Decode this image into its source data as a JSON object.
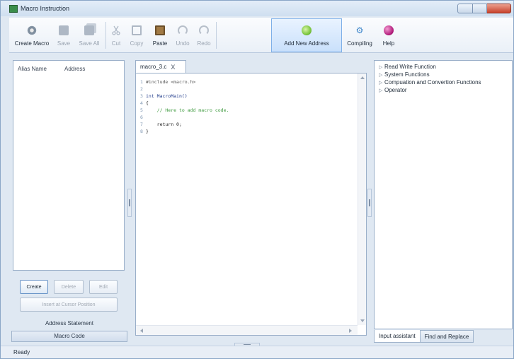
{
  "window": {
    "title": "Macro Instruction"
  },
  "toolbar": {
    "create_macro": "Create Macro",
    "save": "Save",
    "save_all": "Save All",
    "cut": "Cut",
    "copy": "Copy",
    "paste": "Paste",
    "undo": "Undo",
    "redo": "Redo",
    "add_new_address": "Add New Address",
    "compiling": "Compiling",
    "help": "Help"
  },
  "left_panel": {
    "columns": [
      "Alias Name",
      "Address"
    ],
    "buttons": {
      "create": "Create",
      "delete": "Delete",
      "edit": "Edit",
      "insert": "Insert at Cursor Position"
    },
    "section_label": "Address Statement",
    "tab_label": "Macro Code"
  },
  "editor": {
    "tab_label": "macro_3.c",
    "tab_close": "X",
    "lines": [
      {
        "n": "1",
        "text": "#include <macro.h>",
        "kind": "inc"
      },
      {
        "n": "2",
        "text": "",
        "kind": "plain"
      },
      {
        "n": "3",
        "text": "int MacroMain()",
        "kind": "kw"
      },
      {
        "n": "4",
        "text": "{",
        "kind": "plain"
      },
      {
        "n": "5",
        "text": "    // Here to add macro code.",
        "kind": "cm"
      },
      {
        "n": "6",
        "text": "",
        "kind": "plain"
      },
      {
        "n": "7",
        "text": "    return 0;",
        "kind": "plain"
      },
      {
        "n": "8",
        "text": "}",
        "kind": "plain"
      }
    ]
  },
  "right_panel": {
    "items": [
      "Read Write Function",
      "System Functions",
      "Compuation and Convertion Functions",
      "Operator"
    ],
    "tabs": [
      "Input assistant",
      "Find and Replace"
    ]
  },
  "status": {
    "text": "Ready"
  },
  "colors": {
    "active_toolbar_bg": "#c9e0fb",
    "comment": "#3e9a3e",
    "keyword": "#1f3a8a",
    "line_number": "#7f97b2"
  }
}
